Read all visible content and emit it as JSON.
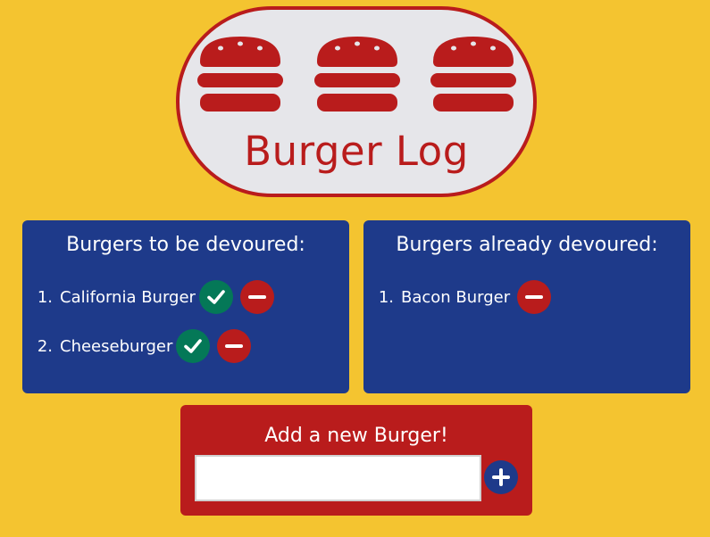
{
  "header": {
    "title": "Burger Log",
    "icons": [
      "burger-icon",
      "burger-icon",
      "burger-icon"
    ]
  },
  "to_devour": {
    "title": "Burgers to be devoured:",
    "items": [
      {
        "num": "1.",
        "name": "California Burger"
      },
      {
        "num": "2.",
        "name": "Cheeseburger"
      }
    ]
  },
  "devoured": {
    "title": "Burgers already devoured:",
    "items": [
      {
        "num": "1.",
        "name": "Bacon Burger"
      }
    ]
  },
  "add_form": {
    "title": "Add a new Burger!",
    "input_value": "",
    "input_placeholder": "",
    "submit_icon": "plus-icon"
  },
  "colors": {
    "background": "#f4c430",
    "red": "#b91c1c",
    "blue": "#1e3a8a",
    "green": "#047857",
    "header_fill": "#e6e6ea"
  }
}
